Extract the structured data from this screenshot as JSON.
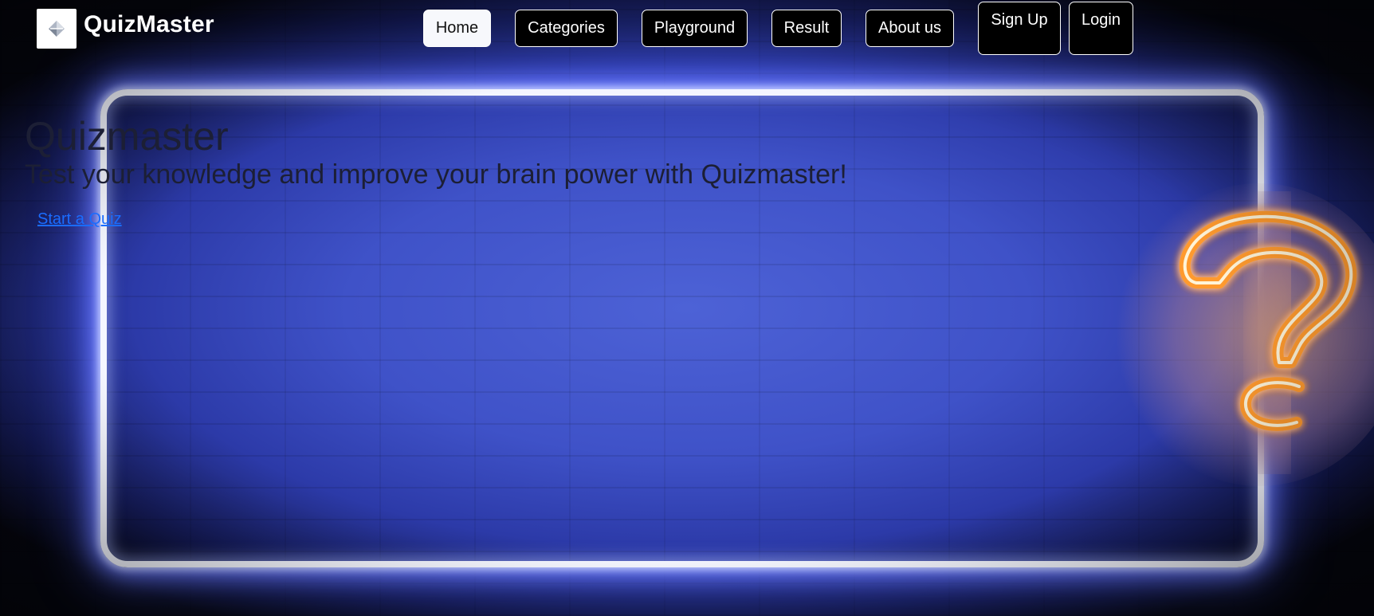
{
  "brand": {
    "name": "QuizMaster",
    "logo_icon": "quiz-logo-icon"
  },
  "nav": {
    "items": [
      {
        "label": "Home",
        "active": true
      },
      {
        "label": "Categories",
        "active": false
      },
      {
        "label": "Playground",
        "active": false
      },
      {
        "label": "Result",
        "active": false
      },
      {
        "label": "About us",
        "active": false
      }
    ],
    "sign_up": "Sign Up",
    "login": "Login"
  },
  "hero": {
    "title": "Quizmaster",
    "subtitle": "Test your knowledge and improve your brain power with Quizmaster!",
    "cta": "Start a Quiz"
  },
  "background": {
    "decoration_icon": "neon-question-mark-icon"
  },
  "colors": {
    "accent": "#1a6cff",
    "neon_frame": "#f4f6ff",
    "neon_question_mark": "#ffa43a",
    "background_blue": "#3f52c8"
  }
}
